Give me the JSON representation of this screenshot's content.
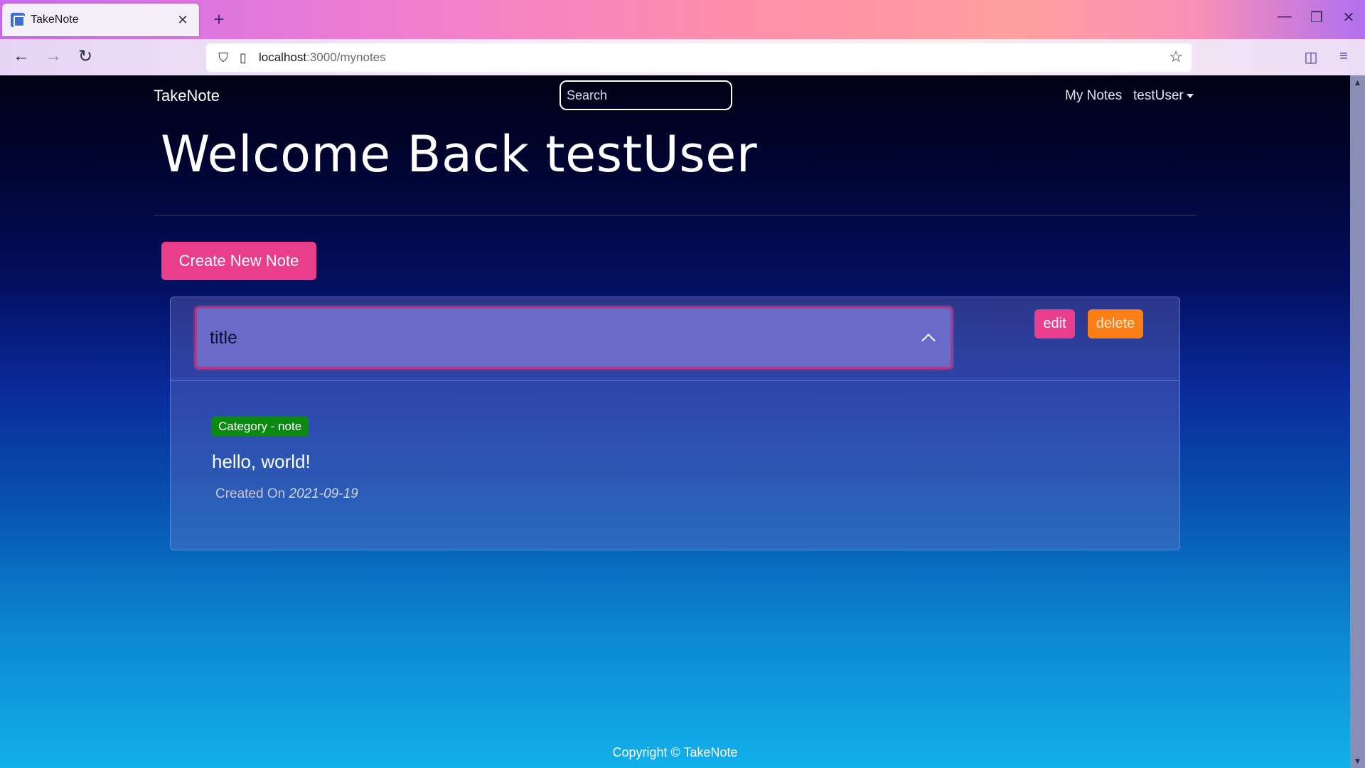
{
  "browser": {
    "tab_title": "TakeNote",
    "tab_close": "✕",
    "new_tab": "+",
    "url_host": "localhost",
    "url_path": ":3000/mynotes",
    "controls": {
      "minimize": "—",
      "restore": "❐",
      "close": "✕"
    },
    "icons": {
      "back": "←",
      "forward": "→",
      "reload": "↻",
      "shield": "⛉",
      "page": "▯",
      "star": "☆",
      "pocket": "◫",
      "menu": "≡"
    }
  },
  "navbar": {
    "brand": "TakeNote",
    "search_placeholder": "Search",
    "my_notes": "My Notes",
    "user": "testUser"
  },
  "main": {
    "welcome": "Welcome Back testUser",
    "create_button": "Create New Note"
  },
  "notes": [
    {
      "title": "title",
      "category": "Category - note",
      "content": "hello, world!",
      "created_label": "Created On",
      "created_date": "2021-09-19",
      "edit_label": "edit",
      "delete_label": "delete"
    }
  ],
  "footer": {
    "text": "Copyright © TakeNote"
  },
  "colors": {
    "accent_pink": "#e83e8c",
    "accent_orange": "#fd7e14",
    "badge_green": "#0a8a10",
    "accordion_bg": "#6a6ac8"
  }
}
